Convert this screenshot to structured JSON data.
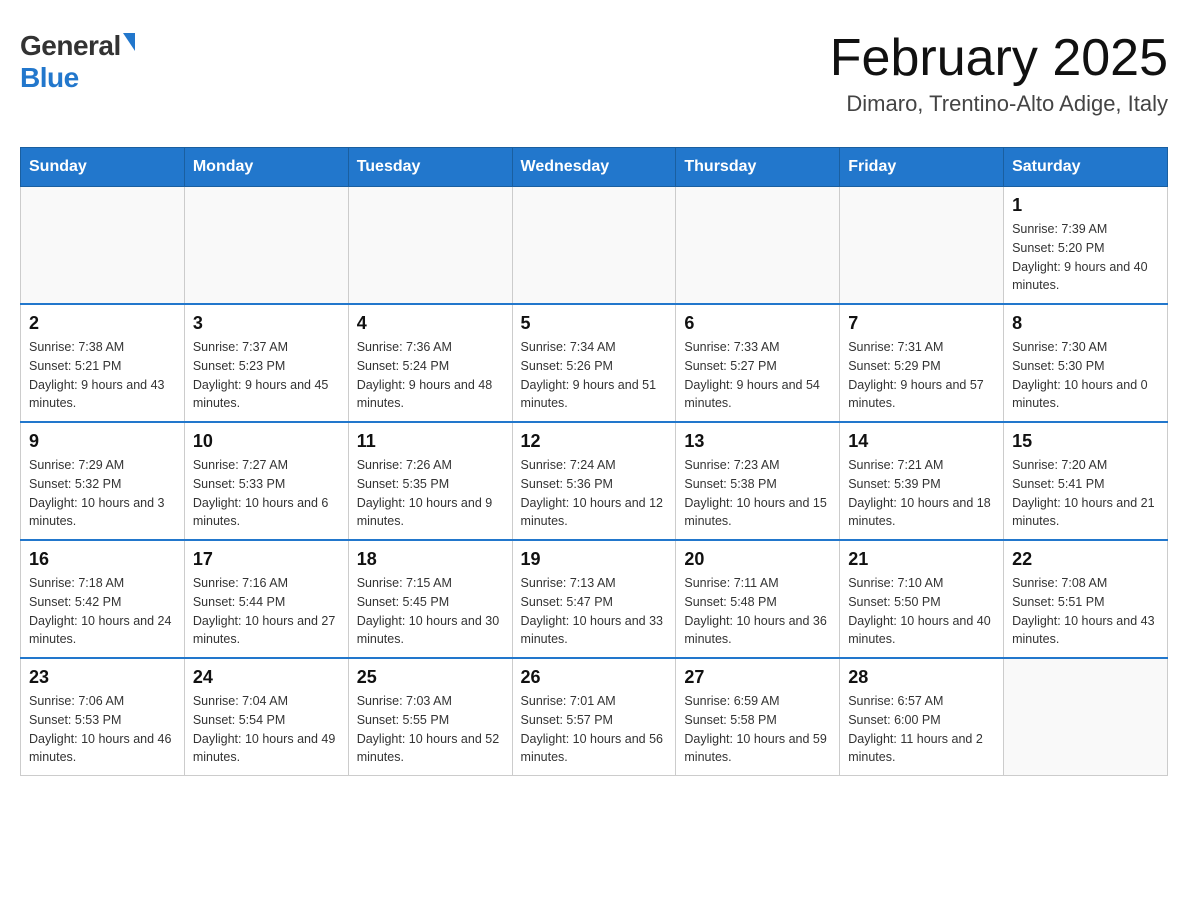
{
  "header": {
    "logo_general": "General",
    "logo_blue": "Blue",
    "month_title": "February 2025",
    "location": "Dimaro, Trentino-Alto Adige, Italy"
  },
  "days_of_week": [
    "Sunday",
    "Monday",
    "Tuesday",
    "Wednesday",
    "Thursday",
    "Friday",
    "Saturday"
  ],
  "weeks": [
    [
      {
        "day": "",
        "info": ""
      },
      {
        "day": "",
        "info": ""
      },
      {
        "day": "",
        "info": ""
      },
      {
        "day": "",
        "info": ""
      },
      {
        "day": "",
        "info": ""
      },
      {
        "day": "",
        "info": ""
      },
      {
        "day": "1",
        "info": "Sunrise: 7:39 AM\nSunset: 5:20 PM\nDaylight: 9 hours and 40 minutes."
      }
    ],
    [
      {
        "day": "2",
        "info": "Sunrise: 7:38 AM\nSunset: 5:21 PM\nDaylight: 9 hours and 43 minutes."
      },
      {
        "day": "3",
        "info": "Sunrise: 7:37 AM\nSunset: 5:23 PM\nDaylight: 9 hours and 45 minutes."
      },
      {
        "day": "4",
        "info": "Sunrise: 7:36 AM\nSunset: 5:24 PM\nDaylight: 9 hours and 48 minutes."
      },
      {
        "day": "5",
        "info": "Sunrise: 7:34 AM\nSunset: 5:26 PM\nDaylight: 9 hours and 51 minutes."
      },
      {
        "day": "6",
        "info": "Sunrise: 7:33 AM\nSunset: 5:27 PM\nDaylight: 9 hours and 54 minutes."
      },
      {
        "day": "7",
        "info": "Sunrise: 7:31 AM\nSunset: 5:29 PM\nDaylight: 9 hours and 57 minutes."
      },
      {
        "day": "8",
        "info": "Sunrise: 7:30 AM\nSunset: 5:30 PM\nDaylight: 10 hours and 0 minutes."
      }
    ],
    [
      {
        "day": "9",
        "info": "Sunrise: 7:29 AM\nSunset: 5:32 PM\nDaylight: 10 hours and 3 minutes."
      },
      {
        "day": "10",
        "info": "Sunrise: 7:27 AM\nSunset: 5:33 PM\nDaylight: 10 hours and 6 minutes."
      },
      {
        "day": "11",
        "info": "Sunrise: 7:26 AM\nSunset: 5:35 PM\nDaylight: 10 hours and 9 minutes."
      },
      {
        "day": "12",
        "info": "Sunrise: 7:24 AM\nSunset: 5:36 PM\nDaylight: 10 hours and 12 minutes."
      },
      {
        "day": "13",
        "info": "Sunrise: 7:23 AM\nSunset: 5:38 PM\nDaylight: 10 hours and 15 minutes."
      },
      {
        "day": "14",
        "info": "Sunrise: 7:21 AM\nSunset: 5:39 PM\nDaylight: 10 hours and 18 minutes."
      },
      {
        "day": "15",
        "info": "Sunrise: 7:20 AM\nSunset: 5:41 PM\nDaylight: 10 hours and 21 minutes."
      }
    ],
    [
      {
        "day": "16",
        "info": "Sunrise: 7:18 AM\nSunset: 5:42 PM\nDaylight: 10 hours and 24 minutes."
      },
      {
        "day": "17",
        "info": "Sunrise: 7:16 AM\nSunset: 5:44 PM\nDaylight: 10 hours and 27 minutes."
      },
      {
        "day": "18",
        "info": "Sunrise: 7:15 AM\nSunset: 5:45 PM\nDaylight: 10 hours and 30 minutes."
      },
      {
        "day": "19",
        "info": "Sunrise: 7:13 AM\nSunset: 5:47 PM\nDaylight: 10 hours and 33 minutes."
      },
      {
        "day": "20",
        "info": "Sunrise: 7:11 AM\nSunset: 5:48 PM\nDaylight: 10 hours and 36 minutes."
      },
      {
        "day": "21",
        "info": "Sunrise: 7:10 AM\nSunset: 5:50 PM\nDaylight: 10 hours and 40 minutes."
      },
      {
        "day": "22",
        "info": "Sunrise: 7:08 AM\nSunset: 5:51 PM\nDaylight: 10 hours and 43 minutes."
      }
    ],
    [
      {
        "day": "23",
        "info": "Sunrise: 7:06 AM\nSunset: 5:53 PM\nDaylight: 10 hours and 46 minutes."
      },
      {
        "day": "24",
        "info": "Sunrise: 7:04 AM\nSunset: 5:54 PM\nDaylight: 10 hours and 49 minutes."
      },
      {
        "day": "25",
        "info": "Sunrise: 7:03 AM\nSunset: 5:55 PM\nDaylight: 10 hours and 52 minutes."
      },
      {
        "day": "26",
        "info": "Sunrise: 7:01 AM\nSunset: 5:57 PM\nDaylight: 10 hours and 56 minutes."
      },
      {
        "day": "27",
        "info": "Sunrise: 6:59 AM\nSunset: 5:58 PM\nDaylight: 10 hours and 59 minutes."
      },
      {
        "day": "28",
        "info": "Sunrise: 6:57 AM\nSunset: 6:00 PM\nDaylight: 11 hours and 2 minutes."
      },
      {
        "day": "",
        "info": ""
      }
    ]
  ]
}
